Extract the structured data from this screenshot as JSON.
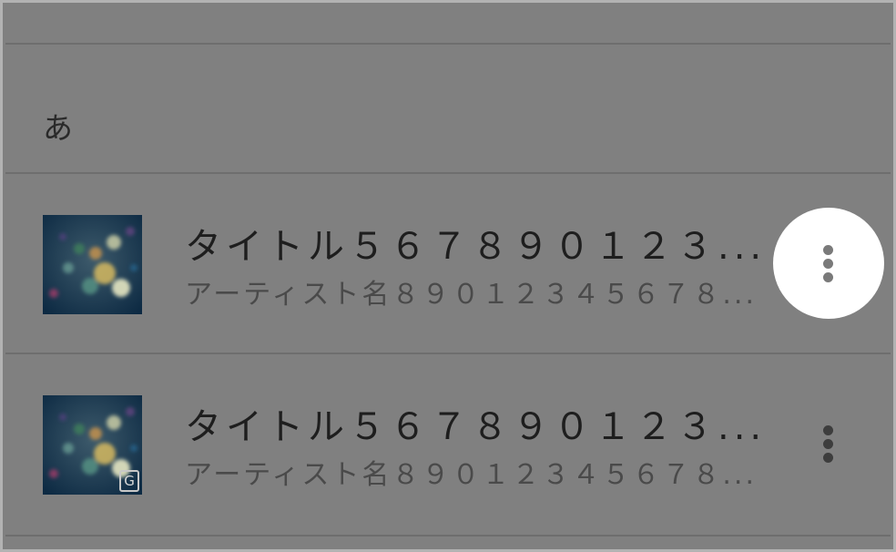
{
  "section": {
    "header": "あ"
  },
  "tracks": [
    {
      "title": "タイトル５６７８９０１２３...",
      "artist": "アーティスト名８９０１２３４５６７８...",
      "more_icon": "more-vert-icon",
      "more_highlighted": true,
      "badge": ""
    },
    {
      "title": "タイトル５６７８９０１２３...",
      "artist": "アーティスト名８９０１２３４５６７８...",
      "more_icon": "more-vert-icon",
      "more_highlighted": false,
      "badge": "G"
    }
  ]
}
